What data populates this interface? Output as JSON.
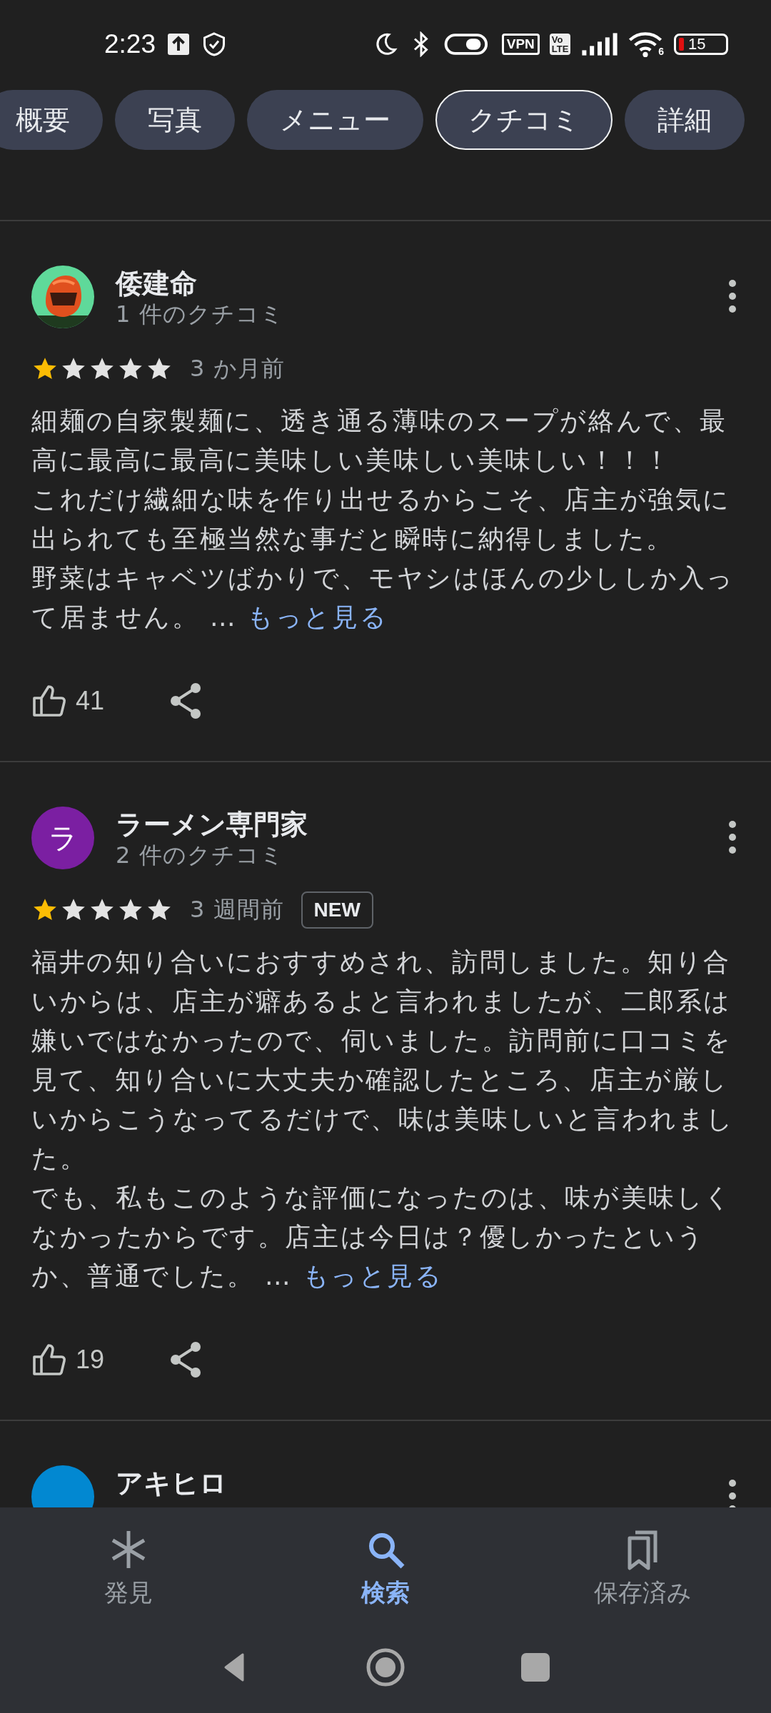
{
  "status_bar": {
    "time": "2:23",
    "vpn": "VPN",
    "volte_top": "Vo",
    "volte_bottom": "LTE",
    "wifi_band": "6",
    "battery": "15"
  },
  "tabs": [
    {
      "label": "概要",
      "selected": false
    },
    {
      "label": "写真",
      "selected": false
    },
    {
      "label": "メニュー",
      "selected": false
    },
    {
      "label": "クチコミ",
      "selected": true
    },
    {
      "label": "詳細",
      "selected": false
    }
  ],
  "reviews": [
    {
      "author": "倭建命",
      "count": "1 件のクチコミ",
      "stars": 1,
      "time": "3 か月前",
      "body": [
        "細麺の自家製麺に、透き通る薄味のスープが絡んで、最高に最高に最高に美味しい美味しい美味しい！！！",
        "これだけ繊細な味を作り出せるからこそ、店主が強気に出られても至極当然な事だと瞬時に納得しました。",
        "野菜はキャベツばかりで、モヤシはほんの少ししか入って居ません。 …"
      ],
      "more": "もっと見る",
      "likes": "41"
    },
    {
      "author": "ラーメン専門家",
      "avatar": {
        "kind": "letter",
        "letter": "ラ",
        "color": "#7b1fa2"
      },
      "count": "2 件のクチコミ",
      "stars": 1,
      "time": "3 週間前",
      "badge": "NEW",
      "body": [
        "福井の知り合いにおすすめされ、訪問しました。知り合いからは、店主が癖あるよと言われましたが、二郎系は嫌いではなかったので、伺いました。訪問前に口コミを見て、知り合いに大丈夫か確認したところ、店主が厳しいからこうなってるだけで、味は美味しいと言われました。",
        "でも、私もこのような評価になったのは、味が美味しくなかったからです。店主は今日は？優しかったというか、普通でした。 …"
      ],
      "more": "もっと見る",
      "likes": "19"
    },
    {
      "author": "アキヒロ",
      "avatar": {
        "kind": "letter",
        "color": "#0288d1"
      }
    }
  ],
  "bottom_nav": [
    {
      "kind": "explore",
      "label": "発見",
      "selected": false
    },
    {
      "kind": "search",
      "label": "検索",
      "selected": true
    },
    {
      "kind": "saved",
      "label": "保存済み",
      "selected": false
    }
  ]
}
